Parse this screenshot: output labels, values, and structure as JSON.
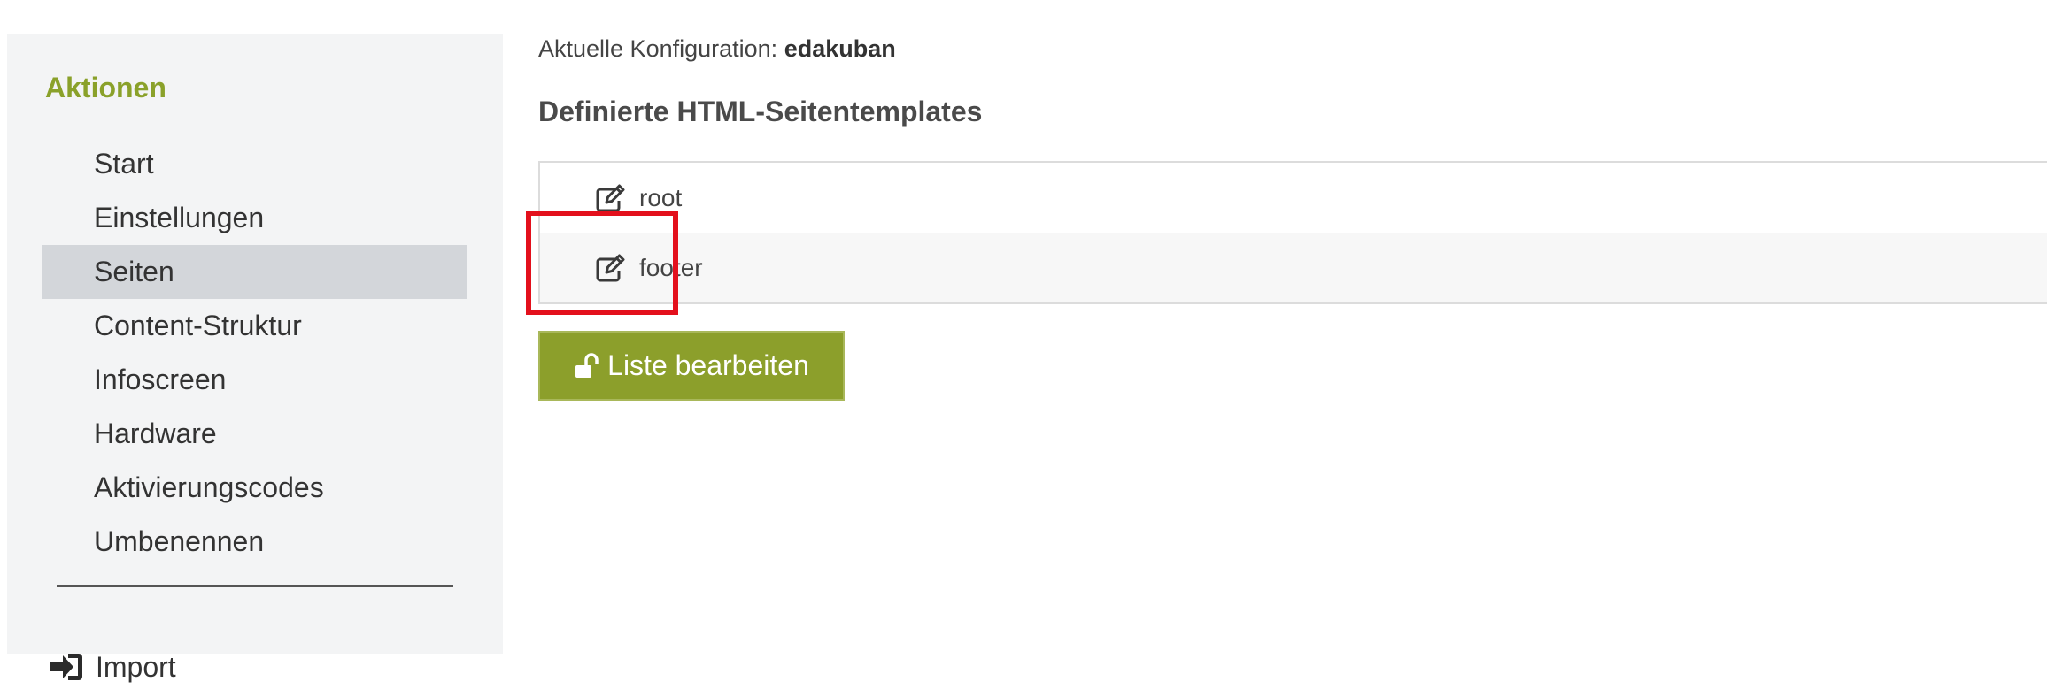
{
  "sidebar": {
    "heading": "Aktionen",
    "items": [
      {
        "label": "Start"
      },
      {
        "label": "Einstellungen"
      },
      {
        "label": "Seiten"
      },
      {
        "label": "Content-Struktur"
      },
      {
        "label": "Infoscreen"
      },
      {
        "label": "Hardware"
      },
      {
        "label": "Aktivierungscodes"
      },
      {
        "label": "Umbenennen"
      }
    ],
    "active_item": "Seiten",
    "import_label": "Import",
    "import_icon": "sign-in-icon"
  },
  "main": {
    "config_label": "Aktuelle Konfiguration:",
    "config_value": "edakuban",
    "section_title": "Definierte HTML-Seitentemplates",
    "templates": [
      {
        "name": "root",
        "icon": "edit-icon"
      },
      {
        "name": "footer",
        "icon": "edit-icon"
      }
    ],
    "edit_list_button": "Liste bearbeiten",
    "edit_list_icon": "unlock-icon"
  },
  "colors": {
    "accent": "#8aa12a",
    "button_bg": "#8c9f2b",
    "sidebar_bg": "#f3f4f5",
    "active_item_bg": "#d3d6da",
    "highlight": "#e3101c"
  }
}
